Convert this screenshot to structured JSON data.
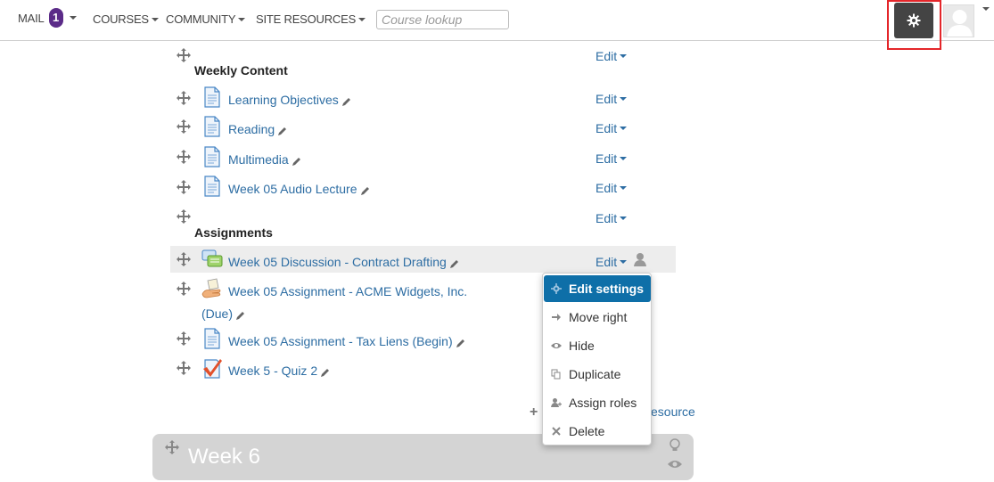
{
  "navbar": {
    "mail_label": "MAIL",
    "mail_count": "1",
    "courses_label": "COURSES",
    "community_label": "COMMUNITY",
    "site_resources_label": "SITE RESOURCES",
    "course_lookup_placeholder": "Course lookup"
  },
  "sections": {
    "weekly_content": "Weekly Content",
    "assignments": "Assignments",
    "edit_label": "Edit"
  },
  "activities": [
    {
      "label": "Learning Objectives",
      "icon": "page-icon"
    },
    {
      "label": "Reading",
      "icon": "page-icon"
    },
    {
      "label": "Multimedia",
      "icon": "page-icon"
    },
    {
      "label": "Week 05 Audio Lecture",
      "icon": "page-icon"
    },
    {
      "label": "Week 05 Discussion - Contract Drafting",
      "icon": "forum-icon"
    },
    {
      "label": "Week 05 Assignment - ACME Widgets, Inc.",
      "label2": "(Due)",
      "icon": "assignment-icon"
    },
    {
      "label": "Week 05 Assignment - Tax Liens (Begin)",
      "icon": "page-icon"
    },
    {
      "label": "Week 5 - Quiz 2",
      "icon": "quiz-icon"
    }
  ],
  "edit_menu": {
    "items": [
      {
        "label": "Edit settings",
        "icon": "gear-icon"
      },
      {
        "label": "Move right",
        "icon": "arrow-right-icon"
      },
      {
        "label": "Hide",
        "icon": "eye-icon"
      },
      {
        "label": "Duplicate",
        "icon": "copy-icon"
      },
      {
        "label": "Assign roles",
        "icon": "user-plus-icon"
      },
      {
        "label": "Delete",
        "icon": "close-icon"
      }
    ]
  },
  "add_resource_label": "esource",
  "week6": {
    "title": "Week 6"
  },
  "colors": {
    "link": "#2d6da3",
    "accent": "#0e6fa8",
    "badge": "#5b2b88",
    "highlight": "#e4262a"
  }
}
